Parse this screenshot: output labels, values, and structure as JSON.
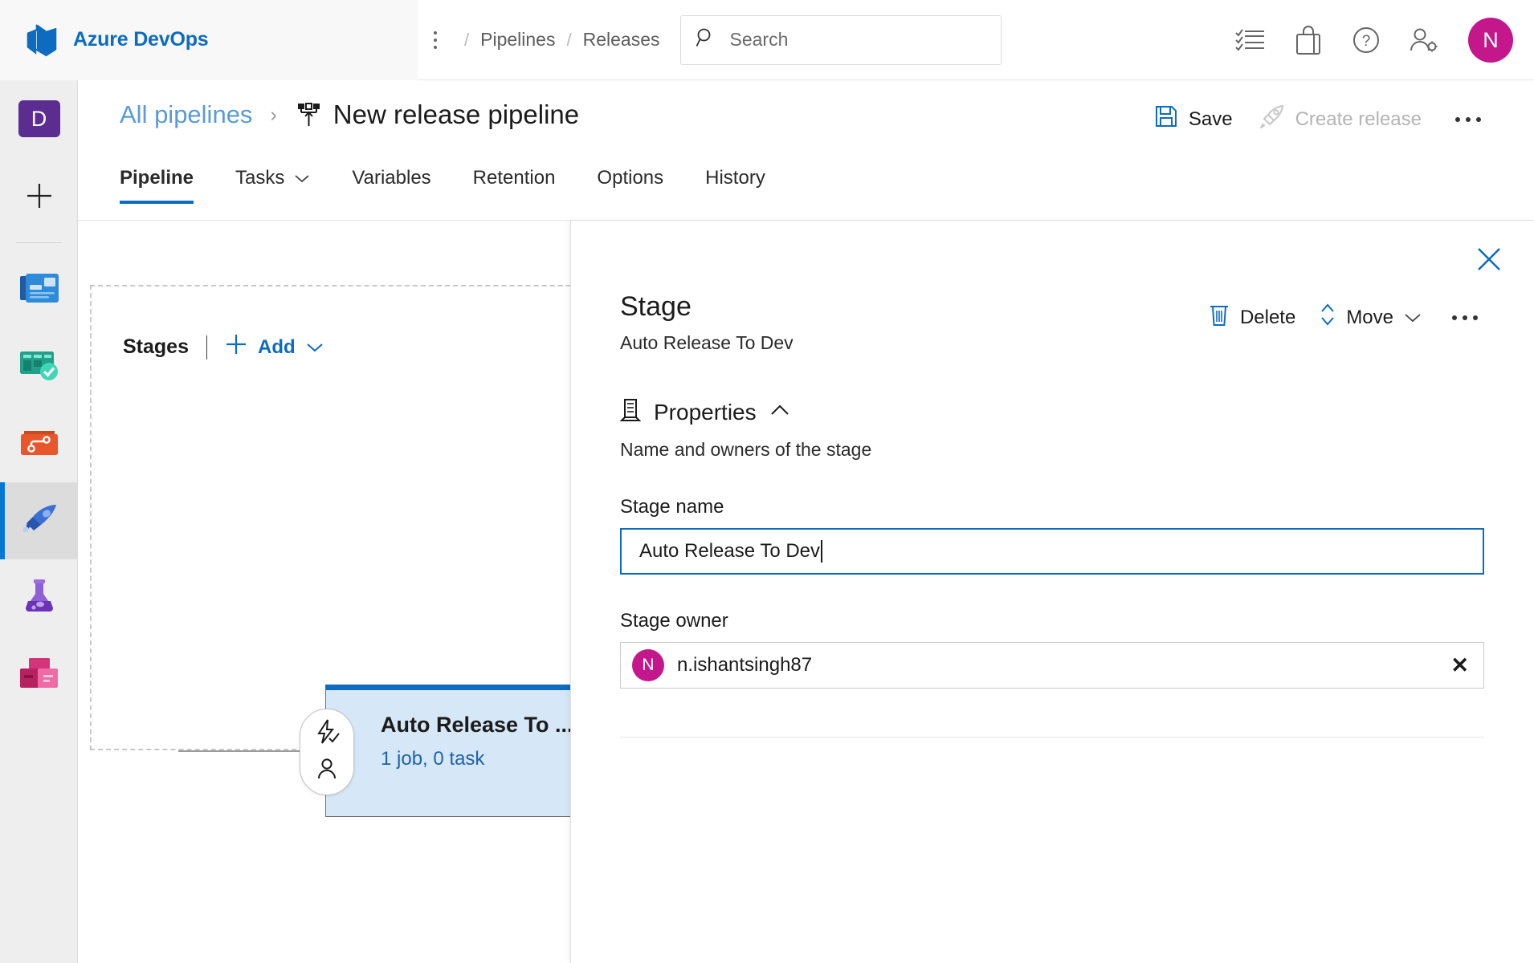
{
  "header": {
    "org_name": "Azure DevOps",
    "logo_icon": "azure-devops-logo",
    "kebab_icon": "more-vertical-icon",
    "breadcrumbs": [
      "Pipelines",
      "Releases"
    ],
    "separator": "/",
    "search": {
      "placeholder": "Search",
      "icon": "search-icon"
    },
    "icons": [
      {
        "name": "checklist-icon",
        "label": "Work items"
      },
      {
        "name": "shopping-bag-icon",
        "label": "Marketplace"
      },
      {
        "name": "question-circle-icon",
        "label": "Help"
      },
      {
        "name": "user-settings-icon",
        "label": "User settings"
      }
    ],
    "avatar": {
      "initial": "N",
      "color": "#c4178c"
    }
  },
  "rail": {
    "project": {
      "initial": "D",
      "color": "#5c2d91"
    },
    "items": [
      {
        "name": "new-item",
        "icon": "plus-icon",
        "label": "New"
      },
      {
        "name": "overview",
        "icon": "overview-icon",
        "label": "Overview"
      },
      {
        "name": "boards",
        "icon": "boards-icon",
        "label": "Boards"
      },
      {
        "name": "repos",
        "icon": "repos-icon",
        "label": "Repos"
      },
      {
        "name": "pipelines",
        "icon": "pipelines-icon",
        "label": "Pipelines",
        "selected": true
      },
      {
        "name": "test-plans",
        "icon": "test-plans-icon",
        "label": "Test Plans"
      },
      {
        "name": "artifacts",
        "icon": "artifacts-icon",
        "label": "Artifacts"
      }
    ]
  },
  "page": {
    "breadcrumb_link": "All pipelines",
    "breadcrumb_chevron": "›",
    "title": "New release pipeline",
    "title_icon": "release-pipeline-icon",
    "commands": {
      "save": {
        "label": "Save",
        "icon": "save-icon",
        "disabled": false
      },
      "create_release": {
        "label": "Create release",
        "icon": "rocket-icon",
        "disabled": true
      },
      "more": {
        "icon": "more-horizontal-icon"
      }
    },
    "tabs": [
      {
        "label": "Pipeline",
        "active": true,
        "caret": false
      },
      {
        "label": "Tasks",
        "active": false,
        "caret": true
      },
      {
        "label": "Variables",
        "active": false,
        "caret": false
      },
      {
        "label": "Retention",
        "active": false,
        "caret": false
      },
      {
        "label": "Options",
        "active": false,
        "caret": false
      },
      {
        "label": "History",
        "active": false,
        "caret": false
      }
    ],
    "active_tab_color": "#0d6cc0"
  },
  "canvas": {
    "stages_label": "Stages",
    "add_label": "Add",
    "add_icon": "plus-icon",
    "add_caret_icon": "chevron-down-icon",
    "stage_card": {
      "title": "Auto Release To ...",
      "subtitle": "1 job, 0 task",
      "accent_color": "#0d6cc0",
      "fill_color": "#d6e7f7",
      "pre_deployment_icons": [
        "lightning-check-icon",
        "person-icon"
      ],
      "post_deployment_icon": "person-icon"
    }
  },
  "panel": {
    "close_icon": "close-icon",
    "title": "Stage",
    "subtitle": "Auto Release To Dev",
    "commands": [
      {
        "label": "Delete",
        "icon": "trash-icon"
      },
      {
        "label": "Move",
        "icon": "move-updown-icon",
        "caret": true
      }
    ],
    "more_icon": "more-horizontal-icon",
    "section": {
      "icon": "properties-icon",
      "title": "Properties",
      "collapse_icon": "chevron-up-icon",
      "description": "Name and owners of the stage"
    },
    "fields": {
      "stage_name": {
        "label": "Stage name",
        "value": "Auto Release To Dev",
        "focused": true
      },
      "stage_owner": {
        "label": "Stage owner",
        "value": "n.ishantsingh87",
        "avatar_initial": "N",
        "avatar_color": "#c4178c",
        "clear_icon": "close-icon"
      }
    }
  }
}
